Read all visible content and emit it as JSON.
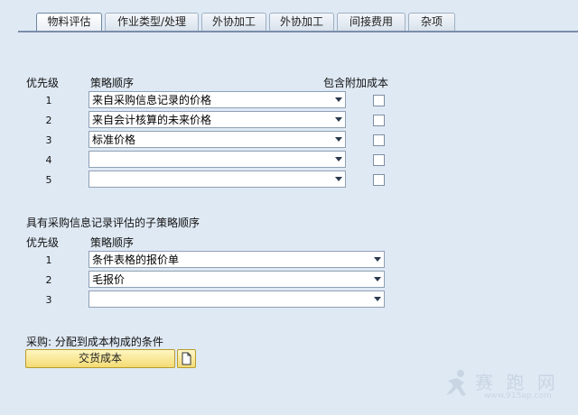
{
  "tabs": [
    "物料评估",
    "作业类型/处理",
    "外协加工",
    "外协加工",
    "间接费用",
    "杂项"
  ],
  "section1": {
    "col_priority": "优先级",
    "col_strategy": "策略顺序",
    "col_include": "包含附加成本",
    "rows": [
      {
        "priority": "1",
        "strategy": "来自采购信息记录的价格"
      },
      {
        "priority": "2",
        "strategy": "来自会计核算的未来价格"
      },
      {
        "priority": "3",
        "strategy": "标准价格"
      },
      {
        "priority": "4",
        "strategy": ""
      },
      {
        "priority": "5",
        "strategy": ""
      }
    ]
  },
  "section2": {
    "title": "具有采购信息记录评估的子策略顺序",
    "col_priority": "优先级",
    "col_strategy": "策略顺序",
    "rows": [
      {
        "priority": "1",
        "strategy": "条件表格的报价单"
      },
      {
        "priority": "2",
        "strategy": "毛报价"
      },
      {
        "priority": "3",
        "strategy": ""
      }
    ]
  },
  "purchase": {
    "label": "采购: 分配到成本构成的条件",
    "button_label": "交货成本"
  },
  "watermark": {
    "text": "赛 跑 网",
    "url": "www.915ap.com"
  }
}
